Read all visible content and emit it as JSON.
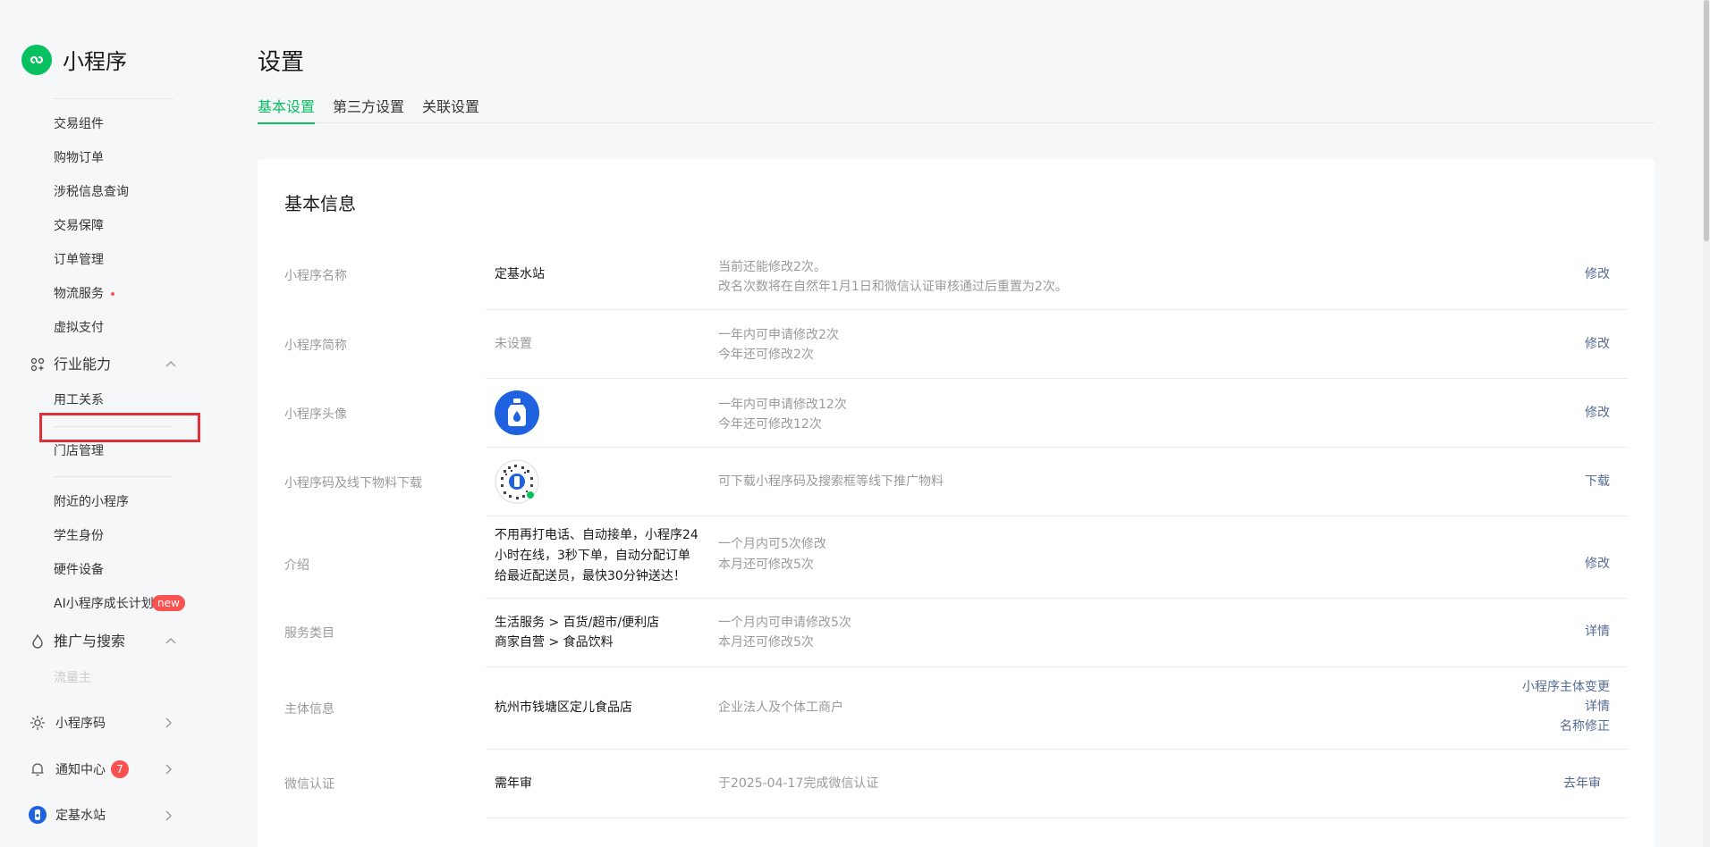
{
  "app": {
    "title": "小程序"
  },
  "sidebar": {
    "items_top": [
      {
        "label": "交易组件"
      },
      {
        "label": "购物订单"
      },
      {
        "label": "涉税信息查询"
      },
      {
        "label": "交易保障"
      },
      {
        "label": "订单管理"
      },
      {
        "label": "物流服务",
        "dot": true
      },
      {
        "label": "虚拟支付"
      }
    ],
    "group_industry": {
      "label": "行业能力",
      "expanded": true
    },
    "industry_items": [
      {
        "label": "用工关系"
      },
      {
        "label": ""
      },
      {
        "label": "门店管理"
      }
    ],
    "more_items": [
      {
        "label": "附近的小程序"
      },
      {
        "label": "学生身份"
      },
      {
        "label": "硬件设备"
      },
      {
        "label": "AI小程序成长计划",
        "badge": "new"
      }
    ],
    "group_promo": {
      "label": "推广与搜索",
      "expanded": true
    },
    "promo_faded_item": {
      "label": "流量主"
    },
    "bottom": {
      "qrcode_label": "小程序码",
      "notify_label": "通知中心",
      "notify_count": "7",
      "account_label": "定基水站"
    }
  },
  "main": {
    "title": "设置",
    "tabs": [
      {
        "label": "基本设置",
        "active": true
      },
      {
        "label": "第三方设置",
        "active": false
      },
      {
        "label": "关联设置",
        "active": false
      }
    ],
    "card_title": "基本信息",
    "rows": [
      {
        "label": "小程序名称",
        "value": "定基水站",
        "desc": [
          "当前还能修改2次。",
          "改名次数将在自然年1月1日和微信认证审核通过后重置为2次。"
        ],
        "actions": [
          "修改"
        ]
      },
      {
        "label": "小程序简称",
        "value": "未设置",
        "desc": [
          "一年内可申请修改2次",
          "今年还可修改2次"
        ],
        "actions": [
          "修改"
        ]
      },
      {
        "label": "小程序头像",
        "value": "",
        "desc": [
          "一年内可申请修改12次",
          "今年还可修改12次"
        ],
        "actions": [
          "修改"
        ]
      },
      {
        "label": "小程序码及线下物料下载",
        "value": "",
        "desc": [
          "可下载小程序码及搜索框等线下推广物料"
        ],
        "actions": [
          "下载"
        ]
      },
      {
        "label": "介绍",
        "value_lines": [
          "不用再打电话、自动接单，小程序24",
          "小时在线，3秒下单，自动分配订单",
          "给最近配送员，最快30分钟送达！"
        ],
        "desc": [
          "一个月内可5次修改",
          "本月还可修改5次"
        ],
        "actions": [
          "修改"
        ]
      },
      {
        "label": "服务类目",
        "value_lines": [
          "生活服务 > 百货/超市/便利店",
          "商家自营 > 食品饮料"
        ],
        "desc": [
          "一个月内可申请修改5次",
          "本月还可修改5次"
        ],
        "actions": [
          "详情"
        ]
      },
      {
        "label": "主体信息",
        "value": "杭州市钱塘区定儿食品店",
        "desc": [
          "企业法人及个体工商户"
        ],
        "actions": [
          "小程序主体变更",
          "详情",
          "名称修正"
        ]
      },
      {
        "label": "微信认证",
        "value": "需年审",
        "desc": [
          "于2025-04-17完成微信认证"
        ],
        "actions": [
          "去年审"
        ]
      }
    ]
  },
  "colors": {
    "accent": "#07c160",
    "link": "#576b95",
    "badge": "#fa5151",
    "avatar": "#1f62e0"
  },
  "icons": [
    "miniprogram-logo-icon",
    "industry-icon",
    "chevron-up-icon",
    "fire-icon",
    "qrcode-icon",
    "bell-icon",
    "chevron-right-icon",
    "water-bottle-icon"
  ]
}
